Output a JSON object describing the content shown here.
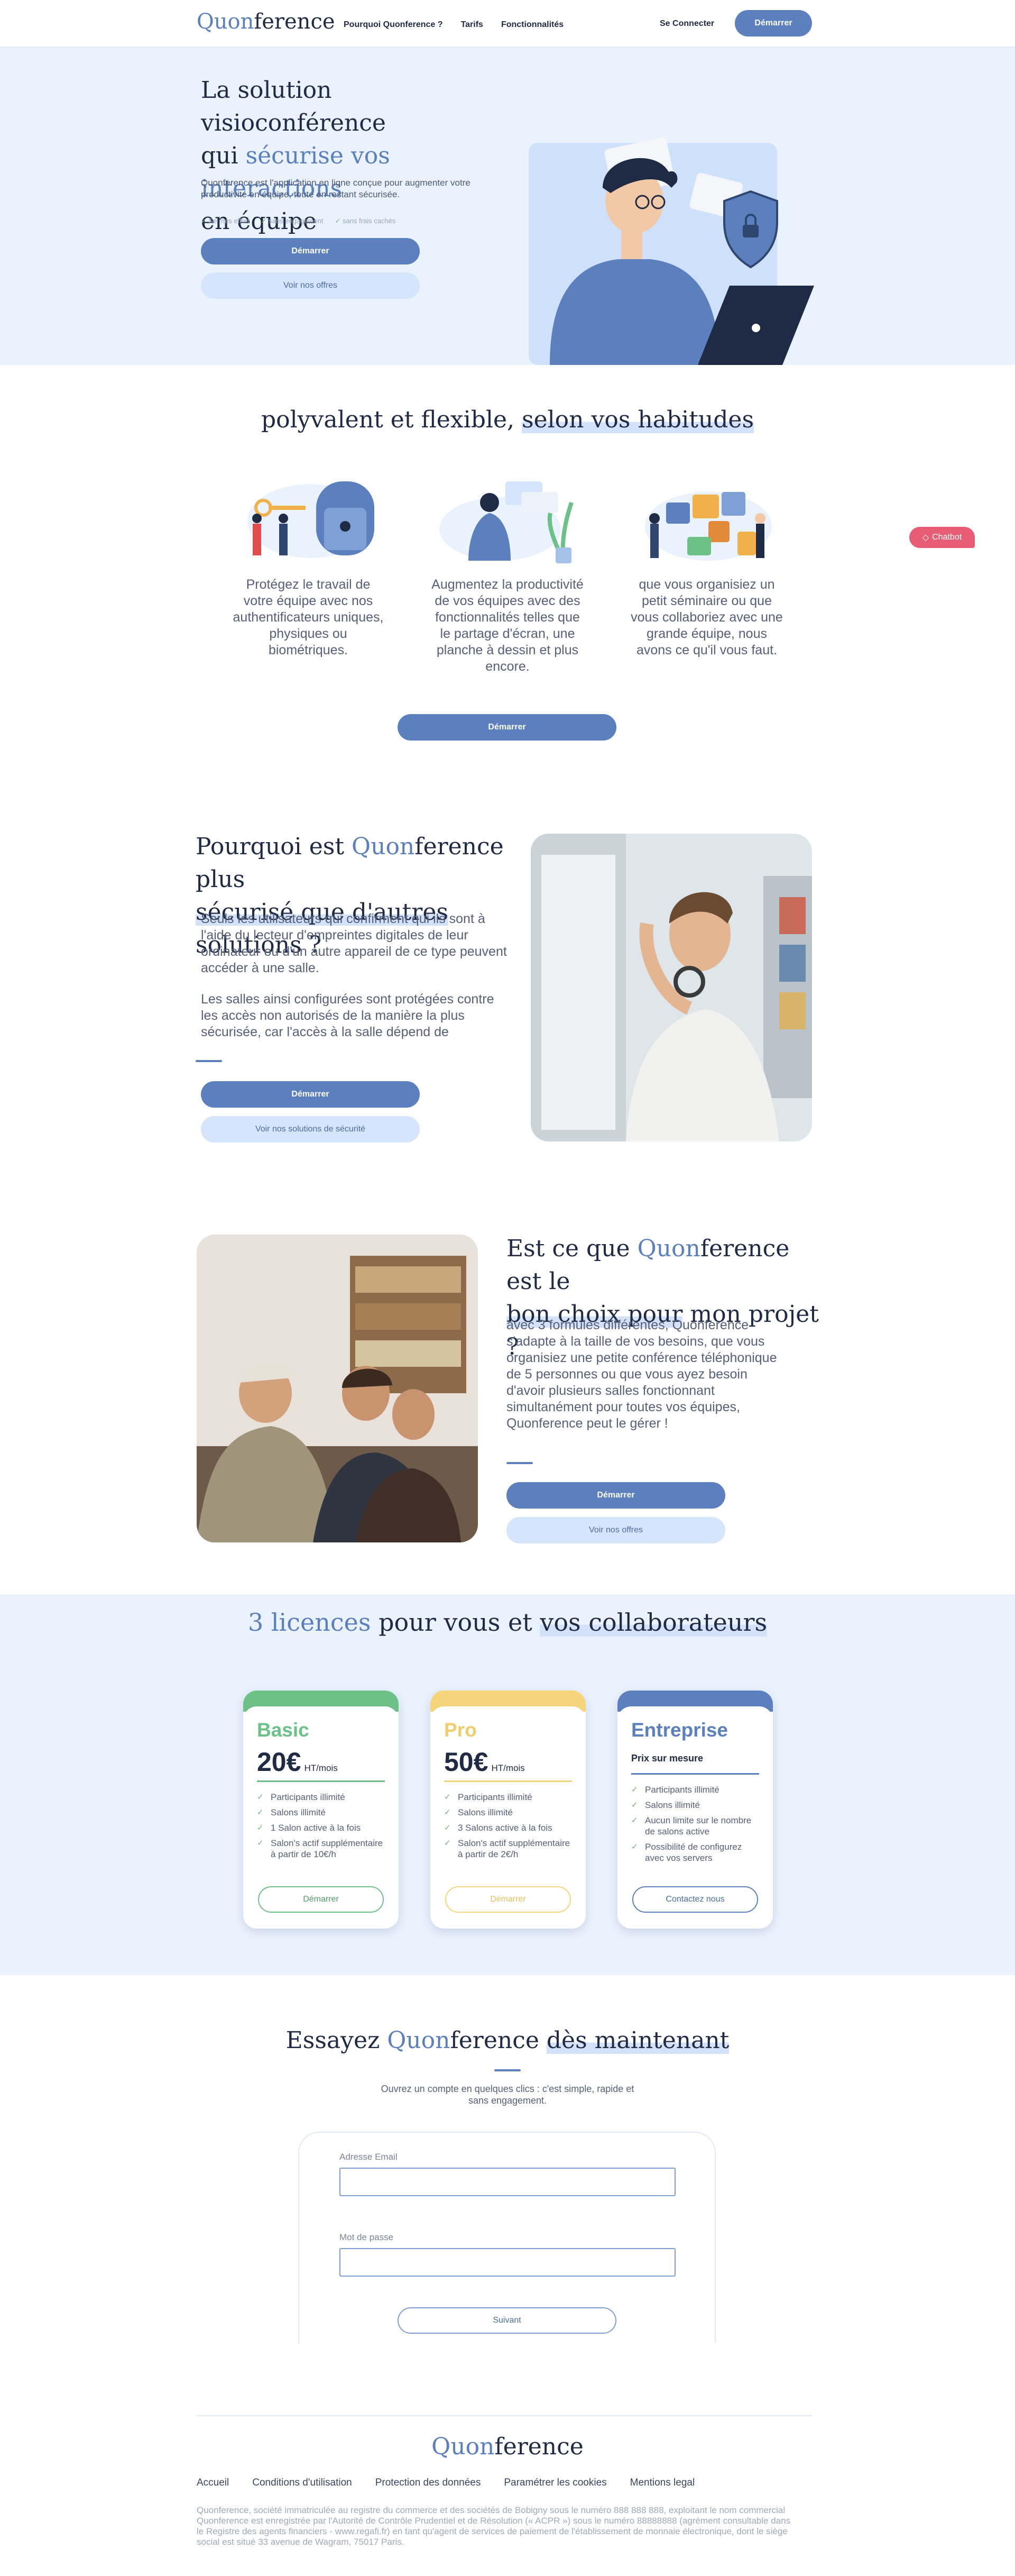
{
  "header": {
    "logo_a": "Quon",
    "logo_b": "ference",
    "nav": [
      "Pourquoi Quonference ?",
      "Tarifs",
      "Fonctionnalités"
    ],
    "login": "Se Connecter",
    "start": "Démarrer"
  },
  "hero": {
    "title_1": "La solution visioconférence",
    "title_2a": "qui ",
    "title_2b": "sécurise vos interactions",
    "title_3": "en équipe",
    "desc": "Quonference est l'application en ligne conçue pour augmenter votre productivité en équipe, toute en restant sécurisée.",
    "checks": [
      "Se mes effort",
      "sans engagement",
      "sans frais cachés"
    ],
    "start": "Démarrer",
    "offers": "Voir nos offres"
  },
  "poly": {
    "title_a": "polyvalent et flexible, ",
    "title_b": "selon vos habitudes",
    "features": [
      "Protégez le travail de votre équipe avec nos authentificateurs uniques, physiques ou biométriques.",
      "Augmentez la productivité de vos équipes avec des fonctionnalités telles que le partage d'écran, une planche à dessin et plus encore.",
      "que vous organisiez un petit séminaire ou que vous collaboriez avec une grande équipe, nous avons ce qu'il vous faut."
    ],
    "start": "Démarrer"
  },
  "chatbot": "Chatbot",
  "why": {
    "title_1a": "Pourquoi est ",
    "title_1b": "Quon",
    "title_1c": "ference plus",
    "title_2a": "sécurisé que d'autres",
    "title_2b": " solutions ?",
    "p1": "Seuls les utilisateurs qui confirment qui ils sont à l'aide du lecteur d'empreintes digitales de leur ordinateur ou d'un autre appareil de ce type peuvent accéder à une salle.",
    "p2": "Les salles ainsi configurées sont protégées contre les accès non autorisés de la manière la plus sécurisée, car l'accès à la salle dépend de",
    "start": "Démarrer",
    "security": "Voir nos solutions de sécurité"
  },
  "choice": {
    "title_1a": "Est ce que ",
    "title_1b": "Quon",
    "title_1c": "ference est le",
    "title_2a": "bon choix pour",
    "title_2b": " mon projet ?",
    "text": "avec 3 formules différentes, Quonference s'adapte à la taille de vos besoins, que vous organisiez une petite conférence téléphonique de 5 personnes ou que vous ayez besoin d'avoir plusieurs salles fonctionnant simultanément pour toutes vos équipes, Quonference peut le gérer !",
    "start": "Démarrer",
    "offers": "Voir nos offres"
  },
  "licences": {
    "title_a": "3 licences",
    "title_b": " pour vous et ",
    "title_c": "vos collaborateurs",
    "plans": [
      {
        "name": "Basic",
        "price": "20€",
        "unit": "HT/mois",
        "color": "#6bc187",
        "features": [
          "Participants illimité",
          "Salons illimité",
          "1 Salon active à la fois",
          "Salon's actif supplémentaire à partir de 10€/h"
        ],
        "button": "Démarrer"
      },
      {
        "name": "Pro",
        "price": "50€",
        "unit": "HT/mois",
        "color": "#f6d57a",
        "features": [
          "Participants illimité",
          "Salons illimité",
          "3 Salons active à la fois",
          "Salon's actif supplémentaire à partir de 2€/h"
        ],
        "button": "Démarrer"
      },
      {
        "name": "Entreprise",
        "price_label": "Prix sur mesure",
        "color": "#5b80bd",
        "features": [
          "Participants illimité",
          "Salons illimité",
          "Aucun limite sur le nombre de salons active",
          "Possibilité de configurez avec vos servers"
        ],
        "button": "Contactez nous"
      }
    ]
  },
  "try": {
    "title_a": "Essayez ",
    "title_b": "Quon",
    "title_c": "ference ",
    "title_d": "dès maintenant",
    "subtitle": "Ouvrez un compte en quelques clics : c'est simple, rapide et sans engagement.",
    "email_label": "Adresse Email",
    "email_value": "",
    "password_label": "Mot de passe",
    "password_value": "",
    "next": "Suivant"
  },
  "footer": {
    "logo_a": "Quon",
    "logo_b": "ference",
    "links": [
      "Accueil",
      "Conditions d'utilisation",
      "Protection des données",
      "Paramétrer les cookies",
      "Mentions legal"
    ],
    "legal": "Quonference, société immatriculée au registre du commerce et des sociétés de Bobigny sous le numéro 888 888 888, exploitant le nom commercial Quonference est enregistrée par l'Autorité de Contrôle Prudentiel et de Résolution (« ACPR ») sous le numéro 88888888 (agrément consultable dans le Registre des agents financiers - www.regafi.fr) en tant qu'agent de services de paiement de l'établissement de monnaie électronique, dont le siège social est situé 33 avenue de Wagram, 75017 Paris."
  }
}
